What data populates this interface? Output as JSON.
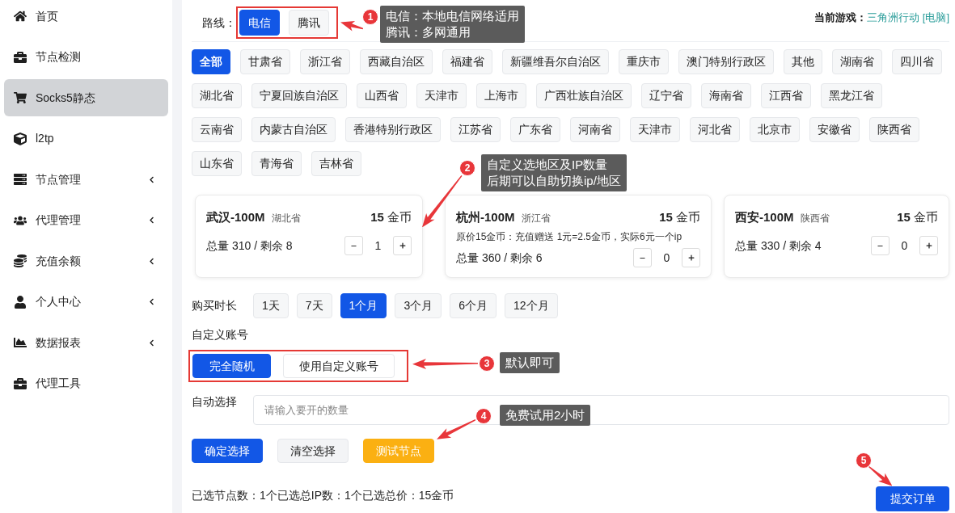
{
  "sidebar": {
    "items": [
      {
        "label": "首页",
        "selected": false,
        "has_submenu": false
      },
      {
        "label": "节点检测",
        "selected": false,
        "has_submenu": false
      },
      {
        "label": "Socks5静态",
        "selected": true,
        "has_submenu": false
      },
      {
        "label": "l2tp",
        "selected": false,
        "has_submenu": false
      },
      {
        "label": "节点管理",
        "selected": false,
        "has_submenu": true
      },
      {
        "label": "代理管理",
        "selected": false,
        "has_submenu": true
      },
      {
        "label": "充值余额",
        "selected": false,
        "has_submenu": true
      },
      {
        "label": "个人中心",
        "selected": false,
        "has_submenu": true
      },
      {
        "label": "数据报表",
        "selected": false,
        "has_submenu": true
      },
      {
        "label": "代理工具",
        "selected": false,
        "has_submenu": false
      }
    ]
  },
  "route": {
    "label": "路线：",
    "framed": true,
    "options": [
      {
        "label": "电信",
        "selected": true
      },
      {
        "label": "腾讯",
        "selected": false
      }
    ]
  },
  "current_game": {
    "label": "当前游戏：",
    "value": "三角洲行动 [电脑]"
  },
  "regions": [
    {
      "label": "全部",
      "selected": true
    },
    {
      "label": "甘肃省",
      "selected": false
    },
    {
      "label": "浙江省",
      "selected": false
    },
    {
      "label": "西藏自治区",
      "selected": false
    },
    {
      "label": "福建省",
      "selected": false
    },
    {
      "label": "新疆维吾尔自治区",
      "selected": false
    },
    {
      "label": "重庆市",
      "selected": false
    },
    {
      "label": "澳门特别行政区",
      "selected": false
    },
    {
      "label": "其他",
      "selected": false
    },
    {
      "label": "湖南省",
      "selected": false
    },
    {
      "label": "四川省",
      "selected": false
    },
    {
      "label": "湖北省",
      "selected": false
    },
    {
      "label": "宁夏回族自治区",
      "selected": false
    },
    {
      "label": "山西省",
      "selected": false
    },
    {
      "label": "天津市",
      "selected": false
    },
    {
      "label": "上海市",
      "selected": false
    },
    {
      "label": "广西壮族自治区",
      "selected": false
    },
    {
      "label": "辽宁省",
      "selected": false
    },
    {
      "label": "海南省",
      "selected": false
    },
    {
      "label": "江西省",
      "selected": false
    },
    {
      "label": "黑龙江省",
      "selected": false
    },
    {
      "label": "云南省",
      "selected": false
    },
    {
      "label": "内蒙古自治区",
      "selected": false
    },
    {
      "label": "香港特别行政区",
      "selected": false
    },
    {
      "label": "江苏省",
      "selected": false
    },
    {
      "label": "广东省",
      "selected": false
    },
    {
      "label": "河南省",
      "selected": false
    },
    {
      "label": "天津市",
      "selected": false
    },
    {
      "label": "河北省",
      "selected": false
    },
    {
      "label": "北京市",
      "selected": false
    },
    {
      "label": "安徽省",
      "selected": false
    },
    {
      "label": "陕西省",
      "selected": false
    },
    {
      "label": "山东省",
      "selected": false
    },
    {
      "label": "青海省",
      "selected": false
    },
    {
      "label": "吉林省",
      "selected": false
    }
  ],
  "nodes": [
    {
      "name": "武汉-100M",
      "province": "湖北省",
      "price": "**15** 金币",
      "stock": "总量 310 / 剩余 8",
      "quantity": "1"
    },
    {
      "name": "杭州-100M",
      "province": "浙江省",
      "price": "**15** 金币",
      "note": "原价15金币：充值赠送 1元=2.5金币，实际6元一个ip",
      "stock": "总量 360 / 剩余 6",
      "quantity": "0"
    },
    {
      "name": "西安-100M",
      "province": "陕西省",
      "price": "**15** 金币",
      "stock": "总量 330 / 剩余 4",
      "quantity": "0"
    }
  ],
  "duration": {
    "label": "购买时长",
    "options": [
      {
        "label": "1天",
        "selected": false
      },
      {
        "label": "7天",
        "selected": false
      },
      {
        "label": "1个月",
        "selected": true
      },
      {
        "label": "3个月",
        "selected": false
      },
      {
        "label": "6个月",
        "selected": false
      },
      {
        "label": "12个月",
        "selected": false
      }
    ]
  },
  "account": {
    "label": "自定义账号",
    "framed": true,
    "options": [
      {
        "label": "完全随机",
        "selected": true
      },
      {
        "label": "使用自定义账号",
        "selected": false
      }
    ]
  },
  "auto_select": {
    "label": "自动选择",
    "placeholder": "请输入要开的数量"
  },
  "actions": [
    {
      "label": "确定选择",
      "kind": "primary"
    },
    {
      "label": "清空选择",
      "kind": "secondary"
    },
    {
      "label": "测试节点",
      "kind": "warning"
    }
  ],
  "summary": "已选节点数：1个已选总IP数：1个已选总价：15金币",
  "submit": {
    "label": "提交订单"
  },
  "annotations": [
    {
      "number": "1",
      "note": [
        "电信：本地电信网络适用",
        "腾讯：多网通用"
      ]
    },
    {
      "number": "2",
      "note": [
        "自定义选地区及IP数量",
        "后期可以自助切换ip/地区"
      ]
    },
    {
      "number": "3",
      "note": [
        "默认即可"
      ]
    },
    {
      "number": "4",
      "note": [
        "免费试用2小时"
      ]
    },
    {
      "number": "5"
    }
  ]
}
